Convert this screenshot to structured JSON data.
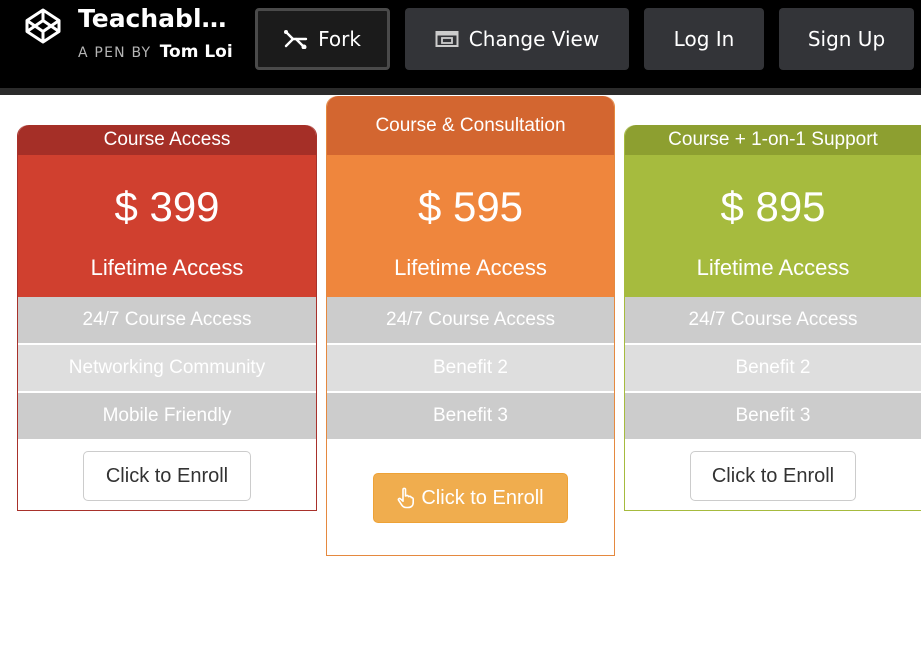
{
  "topbar": {
    "logo_icon": "codepen-logo-icon",
    "pen_title": "Teachabl…",
    "pen_by_label": "A PEN BY",
    "author": "Tom Loi",
    "buttons": {
      "fork": {
        "label": "Fork",
        "icon": "fork-icon"
      },
      "change_view": {
        "label": "Change View",
        "icon": "change-view-icon"
      },
      "login": {
        "label": "Log In"
      },
      "signup": {
        "label": "Sign Up"
      }
    }
  },
  "plans": [
    {
      "header": "Course Access",
      "price": "$ 399",
      "access": "Lifetime Access",
      "features": [
        "24/7 Course Access",
        "Networking Community",
        "Mobile Friendly"
      ],
      "cta": "Click to Enroll",
      "color": "#d0402f"
    },
    {
      "header": "Course & Consultation",
      "price": "$ 595",
      "access": "Lifetime Access",
      "features": [
        "24/7 Course Access",
        "Benefit 2",
        "Benefit 3"
      ],
      "cta": "Click to Enroll",
      "cta_icon": "hand-pointer-icon",
      "color": "#ef863d"
    },
    {
      "header": "Course + 1-on-1 Support",
      "price": "$ 895",
      "access": "Lifetime Access",
      "features": [
        "24/7 Course Access",
        "Benefit 2",
        "Benefit 3"
      ],
      "cta": "Click to Enroll",
      "color": "#a6bb3e"
    }
  ]
}
